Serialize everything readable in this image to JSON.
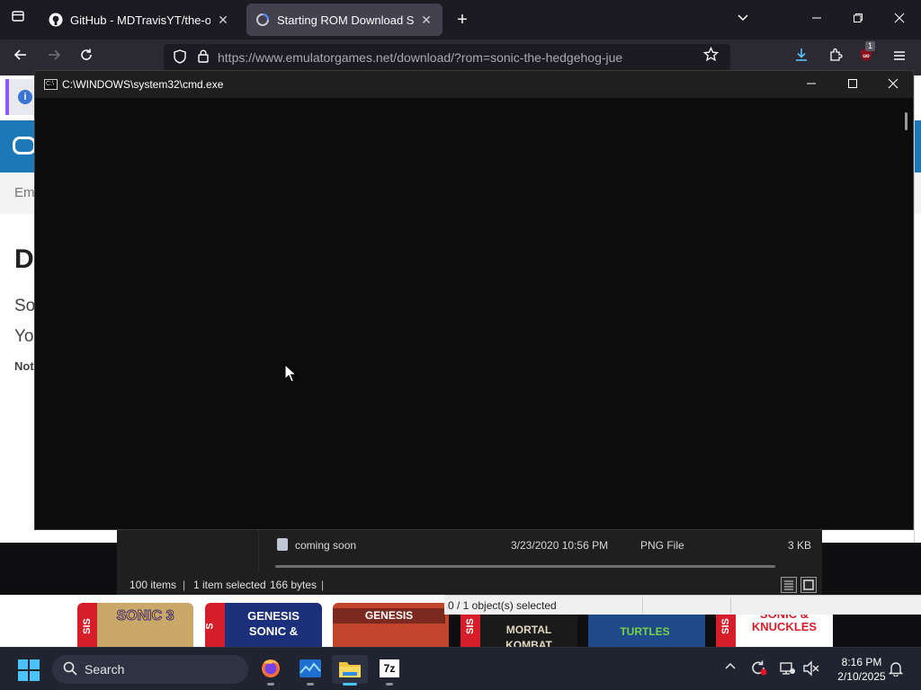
{
  "browser": {
    "tabs": [
      {
        "label": "GitHub - MDTravisYT/the-old-c",
        "close": "✕"
      },
      {
        "label": "Starting ROM Download Sonic",
        "close": "✕"
      }
    ],
    "new_tab": "+",
    "url": "https://www.emulatorgames.net/download/?rom=sonic-the-hedgehog-jue",
    "extension_badge": "1"
  },
  "page": {
    "breadcrumb": "Em",
    "title": "D",
    "line1": "So",
    "line2": "Yo",
    "note": "Not"
  },
  "cmd": {
    "title": "C:\\WINDOWS\\system32\\cmd.exe",
    "icon_text": "C:\\"
  },
  "explorer": {
    "file": {
      "name": "coming soon",
      "date": "3/23/2020 10:56 PM",
      "type": "PNG File",
      "size": "3 KB"
    },
    "status": {
      "items": "100 items",
      "selected": "1 item selected",
      "bytes": "166 bytes"
    }
  },
  "zip": {
    "status": "0 / 1 object(s) selected"
  },
  "thumbnails": [
    {
      "title": "SONIC 3",
      "band": "SIS",
      "color": "#f7c21b",
      "bg": "#c9a86a"
    },
    {
      "title": "GENESIS SONIC &",
      "band": "S",
      "color": "#ffffff",
      "bg": "#1b2f7a"
    },
    {
      "title": "GENESIS",
      "band": "",
      "color": "#ffffff",
      "bg": "#c1452a"
    },
    {
      "title": "MORTAL KOMBAT",
      "band": "SIS",
      "color": "#e0d7c0",
      "bg": "#1a1a1a"
    },
    {
      "title": "TURTLES",
      "band": "",
      "color": "#7ad14b",
      "bg": "#1e4a8a"
    },
    {
      "title": "SONIC & KNUCKLES",
      "band": "SIS",
      "color": "#d61e2a",
      "bg": "#ffffff"
    }
  ],
  "taskbar": {
    "search_label": "Search",
    "time": "8:16 PM",
    "date": "2/10/2025",
    "apps": [
      "firefox-icon",
      "weather-app-icon",
      "file-explorer-icon",
      "7zip-icon"
    ],
    "sevenzip_label": "7z"
  }
}
